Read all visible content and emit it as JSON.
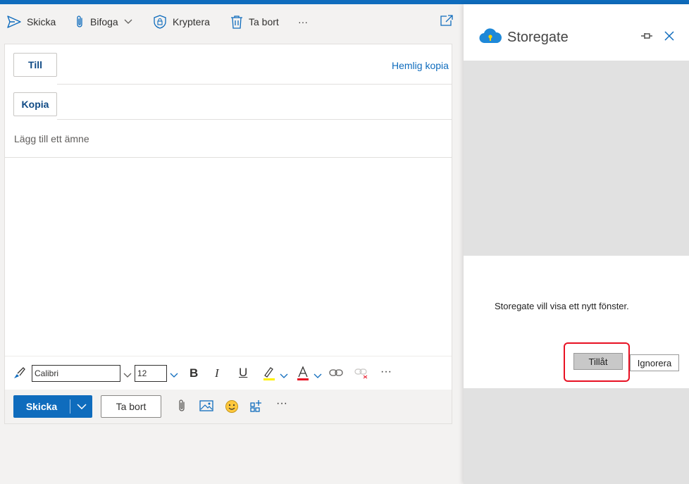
{
  "toolbar": {
    "send": "Skicka",
    "attach": "Bifoga",
    "encrypt": "Kryptera",
    "delete": "Ta bort",
    "more": "···"
  },
  "compose": {
    "to_label": "Till",
    "cc_label": "Kopia",
    "bcc_link": "Hemlig kopia",
    "subject_placeholder": "Lägg till ett ämne",
    "font_name": "Calibri",
    "font_size": "12",
    "format_more": "···",
    "send_label": "Skicka",
    "discard_label": "Ta bort",
    "actions_more": "···"
  },
  "pane": {
    "title": "Storegate",
    "dialog_message": "Storegate vill visa ett nytt fönster.",
    "allow_label": "Tillåt",
    "ignore_label": "Ignorera"
  },
  "colors": {
    "accent": "#0f6cbd",
    "highlight": "#e81123"
  }
}
